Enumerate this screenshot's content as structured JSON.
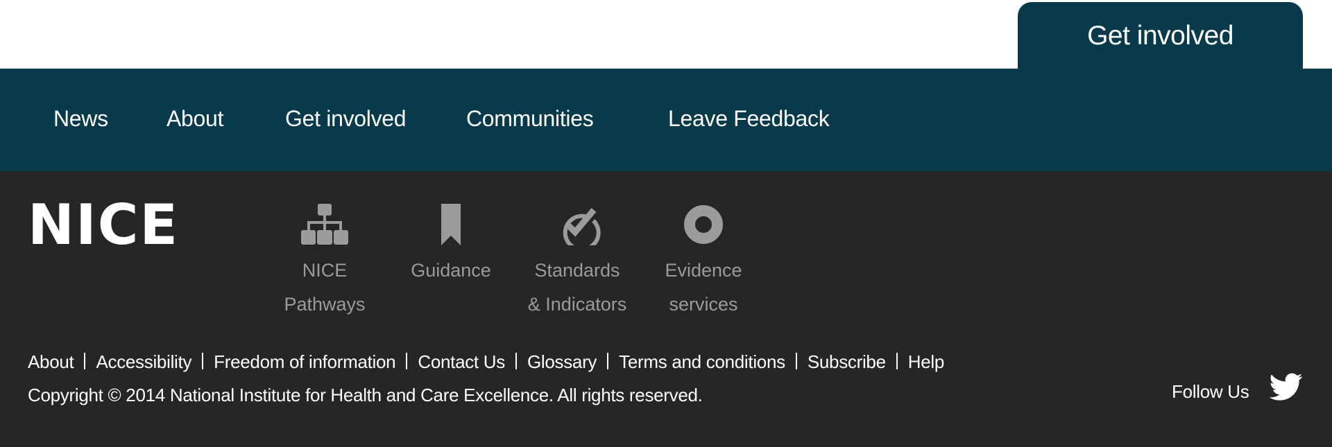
{
  "header": {
    "get_involved_tab": "Get involved"
  },
  "nav": {
    "items": [
      {
        "label": "News"
      },
      {
        "label": "About"
      },
      {
        "label": "Get involved"
      },
      {
        "label": "Communities"
      },
      {
        "label": "Leave Feedback"
      }
    ]
  },
  "footer": {
    "logo_text": "NICE",
    "services": [
      {
        "line1": "NICE",
        "line2": "Pathways",
        "icon": "sitemap-icon"
      },
      {
        "line1": "Guidance",
        "line2": "",
        "icon": "bookmark-icon"
      },
      {
        "line1": "Standards",
        "line2": "& Indicators",
        "icon": "check-circle-icon"
      },
      {
        "line1": "Evidence",
        "line2": "services",
        "icon": "target-circle-icon"
      }
    ],
    "links": [
      "About",
      "Accessibility",
      "Freedom of information",
      "Contact Us",
      "Glossary",
      "Terms and conditions",
      "Subscribe",
      "Help"
    ],
    "copyright": "Copyright © 2014 National Institute for Health and Care Excellence. All rights reserved.",
    "follow_us": "Follow Us",
    "social_icon": "twitter-icon"
  },
  "colors": {
    "brand_teal": "#083a4b",
    "footer_dark": "#262626",
    "service_grey": "#9b9b9b",
    "text_white": "#ffffff"
  }
}
